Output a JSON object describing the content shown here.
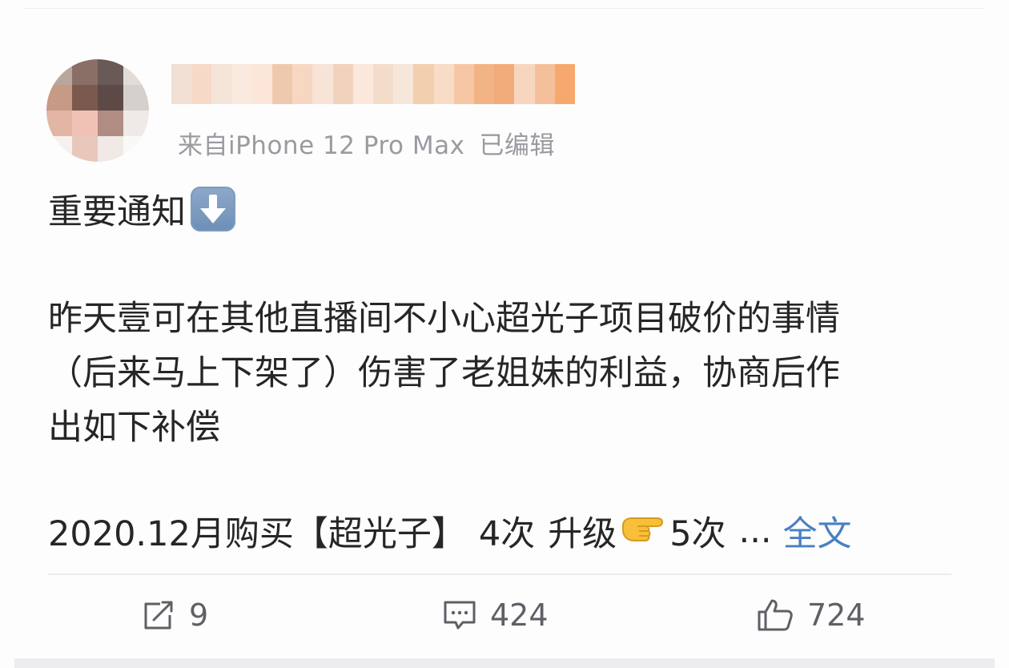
{
  "post": {
    "author": {
      "avatar_pixels": [
        "#b8a79d",
        "#8a6f66",
        "#6a5a57",
        "#e2dcd8",
        "#c79a86",
        "#7a5a4f",
        "#5d4a46",
        "#d6d0cc",
        "#e2b5a4",
        "#f0c2b6",
        "#b08c82",
        "#efeae7",
        "#f6f1ef",
        "#e8c8bb",
        "#f1e9e5",
        "#fbf9f8"
      ],
      "name_blur_colors": [
        "#f1e0d3",
        "#f7d9c8",
        "#f4e4d8",
        "#f9e9de",
        "#fbe6d9",
        "#efc9ae",
        "#f7d7c2",
        "#f8e4d7",
        "#f1d3bd",
        "#fbe7dc",
        "#f4dccb",
        "#f7e6da",
        "#f2cfae",
        "#f9dcc7",
        "#f7c7a5",
        "#f3b485",
        "#f2ab7b",
        "#f7d6bf",
        "#f4c09c",
        "#f6a86d"
      ]
    },
    "source": "来自iPhone 12 Pro Max",
    "edited": "已编辑",
    "title": "重要通知",
    "title_emoji": "down-arrow-emoji",
    "paragraph_lines": [
      "昨天壹可在其他直播间不小心超光子项目破价的事情",
      "（后来马上下架了）伤害了老姐妹的利益，协商后作",
      "出如下补偿"
    ],
    "purchase": {
      "date_item": "2020.12月购买【超光子】",
      "times_before": "4次",
      "upgrade": "升级",
      "times_after": "5次",
      "ellipsis": "...",
      "full_text": "全文"
    }
  },
  "actions": {
    "repost_count": "9",
    "comment_count": "424",
    "like_count": "724"
  },
  "colors": {
    "link": "#4a7fc1",
    "meta_text": "#9a9aa0",
    "action_text": "#5f5f66"
  }
}
